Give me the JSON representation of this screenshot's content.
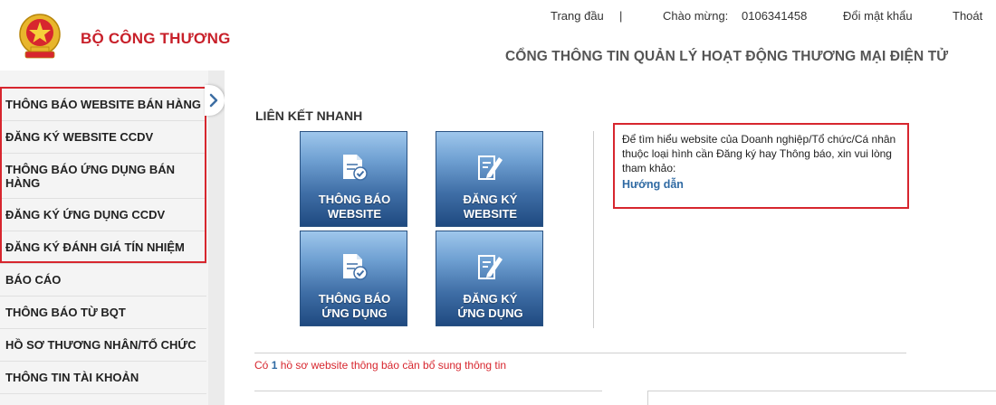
{
  "header": {
    "org_name": "BỘ CÔNG THƯƠNG",
    "portal_title": "CỔNG THÔNG TIN QUẢN LÝ HOẠT ĐỘNG THƯƠNG MẠI ĐIỆN TỬ",
    "logo_icon": "national-emblem-icon",
    "nav": {
      "home": "Trang đầu",
      "separator": "|",
      "greeting": "Chào mừng:",
      "username": "0106341458",
      "change_password": "Đổi mật khẩu",
      "logout": "Thoát"
    }
  },
  "sidebar": {
    "items": [
      {
        "label": "THÔNG BÁO WEBSITE BÁN HÀNG"
      },
      {
        "label": "ĐĂNG KÝ WEBSITE CCDV"
      },
      {
        "label": "THÔNG BÁO ỨNG DỤNG BÁN HÀNG"
      },
      {
        "label": "ĐĂNG KÝ ỨNG DỤNG CCDV"
      },
      {
        "label": "ĐĂNG KÝ ĐÁNH GIÁ TÍN NHIỆM"
      },
      {
        "label": "BÁO CÁO"
      },
      {
        "label": "THÔNG BÁO TỪ BQT"
      },
      {
        "label": "HỒ SƠ THƯƠNG NHÂN/TỔ CHỨC"
      },
      {
        "label": "THÔNG TIN TÀI KHOẢN"
      }
    ],
    "collapse_icon": "chevron-right-icon"
  },
  "quick_links": {
    "title": "LIÊN KẾT NHANH",
    "tiles": [
      {
        "line1": "THÔNG BÁO",
        "line2": "WEBSITE",
        "icon": "document-check-icon"
      },
      {
        "line1": "ĐĂNG KÝ",
        "line2": "WEBSITE",
        "icon": "document-edit-icon"
      },
      {
        "line1": "THÔNG BÁO",
        "line2": "ỨNG DỤNG",
        "icon": "document-check-icon"
      },
      {
        "line1": "ĐĂNG KÝ",
        "line2": "ỨNG DỤNG",
        "icon": "document-edit-icon"
      }
    ]
  },
  "info": {
    "text": "Để tìm hiểu website của Doanh nghiệp/Tổ chức/Cá nhân thuộc loại hình cần Đăng ký hay Thông báo, xin vui lòng tham khảo:",
    "link": "Hướng dẫn"
  },
  "notice": {
    "prefix": "Có",
    "count": "1",
    "suffix": "hồ sơ website thông báo cần bổ sung thông tin"
  },
  "colors": {
    "brand_red": "#c8202a",
    "highlight_red": "#d7262e",
    "link_blue": "#2f6aa3",
    "tile_dark_blue": "#1f4a80"
  }
}
